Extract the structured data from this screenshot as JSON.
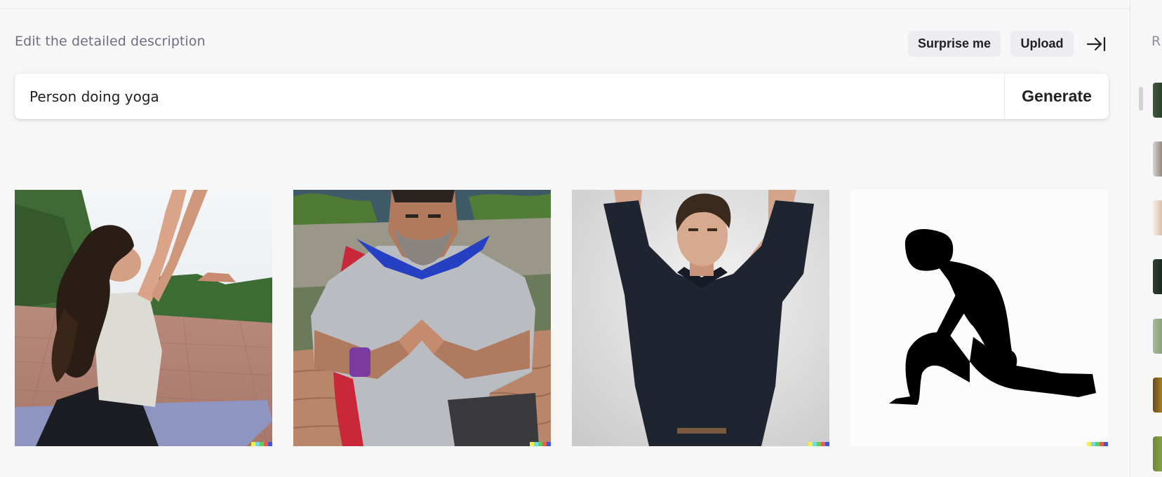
{
  "prompt": {
    "heading": "Edit the detailed description",
    "surprise_label": "Surprise me",
    "upload_label": "Upload",
    "collapse_icon": "arrow-right-to-bar-icon",
    "input_value": "Person doing yoga",
    "generate_label": "Generate"
  },
  "results": [
    {
      "alt": "Woman with long curly hair doing a yoga stretch on a terrace"
    },
    {
      "alt": "Bearded man wearing a red and blue cape making a hand gesture"
    },
    {
      "alt": "Young man in a navy long-sleeve shirt with arms raised"
    },
    {
      "alt": "Black silhouette of a person in a kneeling lunge pose"
    }
  ],
  "signature_colors": [
    "#f6ee41",
    "#6fd8ea",
    "#5bd05a",
    "#ee5b46",
    "#3f58d8"
  ],
  "sidebar": {
    "heading": "R",
    "history_count": 7
  }
}
